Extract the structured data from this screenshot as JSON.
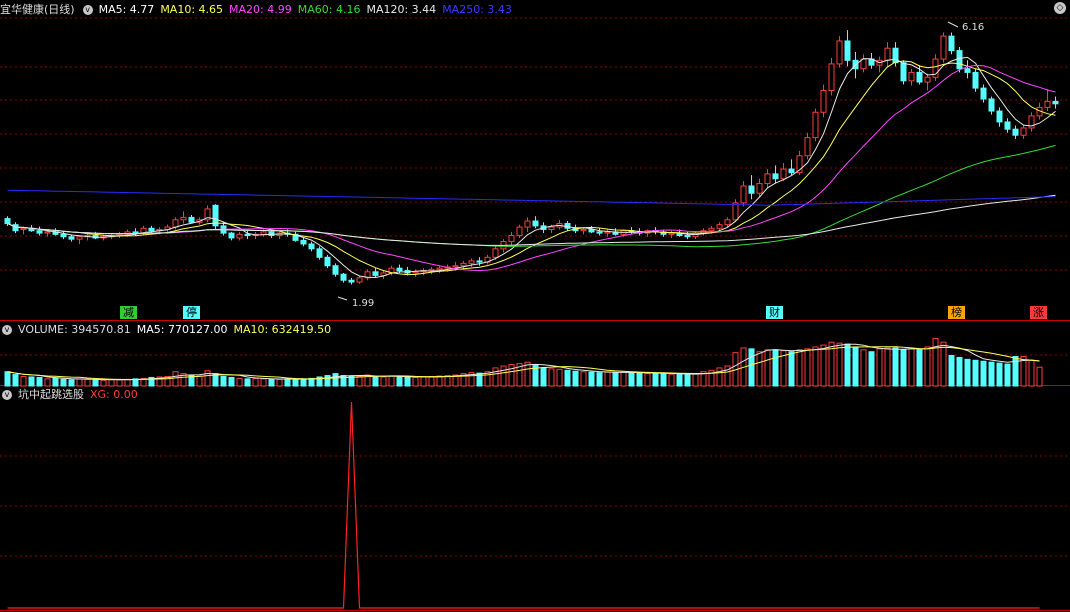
{
  "colors": {
    "up": "#ff3a3a",
    "down": "#54ffff",
    "ma5": "#e8e8e8",
    "ma10": "#ffff55",
    "ma20": "#ff44ff",
    "ma60": "#33dd33",
    "ma120": "#e8e8e8",
    "ma250": "#2a2aff",
    "grid": "#8b0000",
    "signal": "#ff2222"
  },
  "header": {
    "stock_name": "宜华健康(日线)",
    "ma5": "MA5: 4.77",
    "ma10": "MA10: 4.65",
    "ma20": "MA20: 4.99",
    "ma60": "MA60: 4.16",
    "ma120": "MA120: 3.44",
    "ma250": "MA250: 3.43"
  },
  "volume_header": {
    "volume": "VOLUME: 394570.81",
    "ma5": "MA5: 770127.00",
    "ma10": "MA10: 632419.50"
  },
  "indicator_header": {
    "name": "坑中起跳选股",
    "xg": "XG: 0.00"
  },
  "icons": {
    "collapse": "chevron-down-icon",
    "settings": "diamond-icon"
  },
  "annotations": {
    "low": "1.99",
    "high": "6.16",
    "markers": [
      {
        "text": "减",
        "bg": "#33cc33"
      },
      {
        "text": "停",
        "bg": "#54ffff"
      },
      {
        "text": "财",
        "bg": "#54ffff"
      },
      {
        "text": "榜",
        "bg": "#ffa500"
      },
      {
        "text": "涨",
        "bg": "#ff3a3a"
      }
    ]
  },
  "chart_data": [
    {
      "type": "candlestick",
      "ylim": [
        1.7,
        6.4
      ],
      "series_ohlc": [
        [
          3.08,
          3.12,
          2.96,
          3.0
        ],
        [
          2.98,
          3.02,
          2.84,
          2.88
        ],
        [
          2.9,
          2.95,
          2.82,
          2.92
        ],
        [
          2.92,
          2.97,
          2.86,
          2.88
        ],
        [
          2.88,
          2.95,
          2.8,
          2.84
        ],
        [
          2.84,
          2.9,
          2.78,
          2.86
        ],
        [
          2.86,
          2.92,
          2.8,
          2.82
        ],
        [
          2.82,
          2.87,
          2.74,
          2.78
        ],
        [
          2.78,
          2.82,
          2.7,
          2.74
        ],
        [
          2.74,
          2.8,
          2.66,
          2.78
        ],
        [
          2.78,
          2.84,
          2.72,
          2.8
        ],
        [
          2.8,
          2.86,
          2.74,
          2.76
        ],
        [
          2.76,
          2.82,
          2.72,
          2.78
        ],
        [
          2.78,
          2.84,
          2.74,
          2.8
        ],
        [
          2.8,
          2.86,
          2.76,
          2.82
        ],
        [
          2.82,
          2.9,
          2.78,
          2.86
        ],
        [
          2.86,
          2.92,
          2.8,
          2.84
        ],
        [
          2.84,
          2.96,
          2.8,
          2.92
        ],
        [
          2.92,
          2.96,
          2.84,
          2.88
        ],
        [
          2.88,
          2.94,
          2.82,
          2.9
        ],
        [
          2.9,
          2.98,
          2.86,
          2.94
        ],
        [
          2.94,
          3.1,
          2.9,
          3.06
        ],
        [
          3.06,
          3.2,
          3.0,
          3.1
        ],
        [
          3.1,
          3.14,
          3.0,
          3.02
        ],
        [
          3.02,
          3.1,
          2.98,
          3.06
        ],
        [
          3.06,
          3.3,
          3.02,
          3.24
        ],
        [
          3.3,
          3.32,
          2.9,
          2.96
        ],
        [
          2.96,
          3.02,
          2.8,
          2.84
        ],
        [
          2.84,
          2.86,
          2.72,
          2.76
        ],
        [
          2.76,
          2.86,
          2.72,
          2.82
        ],
        [
          2.82,
          2.88,
          2.74,
          2.8
        ],
        [
          2.8,
          2.86,
          2.74,
          2.82
        ],
        [
          2.82,
          2.9,
          2.78,
          2.86
        ],
        [
          2.86,
          2.9,
          2.76,
          2.8
        ],
        [
          2.8,
          2.86,
          2.74,
          2.84
        ],
        [
          2.84,
          2.9,
          2.78,
          2.82
        ],
        [
          2.82,
          2.86,
          2.7,
          2.72
        ],
        [
          2.72,
          2.76,
          2.62,
          2.66
        ],
        [
          2.66,
          2.7,
          2.54,
          2.58
        ],
        [
          2.58,
          2.62,
          2.4,
          2.44
        ],
        [
          2.44,
          2.48,
          2.26,
          2.3
        ],
        [
          2.3,
          2.34,
          2.12,
          2.16
        ],
        [
          2.16,
          2.18,
          2.02,
          2.06
        ],
        [
          2.06,
          2.1,
          1.99,
          2.03
        ],
        [
          2.03,
          2.14,
          2.0,
          2.1
        ],
        [
          2.1,
          2.24,
          2.06,
          2.2
        ],
        [
          2.2,
          2.26,
          2.1,
          2.14
        ],
        [
          2.14,
          2.22,
          2.08,
          2.18
        ],
        [
          2.18,
          2.3,
          2.14,
          2.26
        ],
        [
          2.26,
          2.32,
          2.18,
          2.22
        ],
        [
          2.22,
          2.28,
          2.14,
          2.18
        ],
        [
          2.18,
          2.24,
          2.12,
          2.2
        ],
        [
          2.2,
          2.26,
          2.14,
          2.22
        ],
        [
          2.22,
          2.28,
          2.16,
          2.24
        ],
        [
          2.24,
          2.3,
          2.18,
          2.26
        ],
        [
          2.26,
          2.32,
          2.2,
          2.28
        ],
        [
          2.28,
          2.36,
          2.22,
          2.3
        ],
        [
          2.3,
          2.38,
          2.24,
          2.34
        ],
        [
          2.34,
          2.42,
          2.28,
          2.38
        ],
        [
          2.38,
          2.44,
          2.3,
          2.36
        ],
        [
          2.36,
          2.48,
          2.32,
          2.44
        ],
        [
          2.44,
          2.62,
          2.4,
          2.58
        ],
        [
          2.58,
          2.74,
          2.52,
          2.7
        ],
        [
          2.7,
          2.86,
          2.64,
          2.8
        ],
        [
          2.8,
          2.98,
          2.76,
          2.94
        ],
        [
          2.94,
          3.1,
          2.86,
          3.04
        ],
        [
          3.04,
          3.12,
          2.92,
          2.96
        ],
        [
          2.96,
          3.02,
          2.84,
          2.9
        ],
        [
          2.9,
          2.98,
          2.84,
          2.94
        ],
        [
          2.94,
          3.06,
          2.9,
          3.0
        ],
        [
          3.0,
          3.04,
          2.88,
          2.92
        ],
        [
          2.92,
          2.98,
          2.84,
          2.88
        ],
        [
          2.88,
          2.94,
          2.82,
          2.9
        ],
        [
          2.9,
          2.96,
          2.84,
          2.86
        ],
        [
          2.86,
          2.92,
          2.8,
          2.84
        ],
        [
          2.84,
          2.9,
          2.78,
          2.86
        ],
        [
          2.86,
          2.92,
          2.8,
          2.82
        ],
        [
          2.82,
          2.9,
          2.78,
          2.88
        ],
        [
          2.88,
          2.94,
          2.82,
          2.86
        ],
        [
          2.86,
          2.92,
          2.8,
          2.84
        ],
        [
          2.84,
          2.9,
          2.78,
          2.88
        ],
        [
          2.88,
          2.94,
          2.82,
          2.86
        ],
        [
          2.86,
          2.9,
          2.78,
          2.82
        ],
        [
          2.82,
          2.88,
          2.76,
          2.84
        ],
        [
          2.84,
          2.9,
          2.78,
          2.8
        ],
        [
          2.8,
          2.86,
          2.74,
          2.78
        ],
        [
          2.78,
          2.86,
          2.74,
          2.84
        ],
        [
          2.84,
          2.92,
          2.8,
          2.88
        ],
        [
          2.88,
          2.96,
          2.84,
          2.92
        ],
        [
          2.92,
          3.02,
          2.88,
          2.98
        ],
        [
          2.98,
          3.1,
          2.94,
          3.06
        ],
        [
          3.06,
          3.4,
          3.02,
          3.34
        ],
        [
          3.34,
          3.7,
          3.28,
          3.62
        ],
        [
          3.62,
          3.8,
          3.4,
          3.5
        ],
        [
          3.5,
          3.74,
          3.44,
          3.66
        ],
        [
          3.66,
          3.9,
          3.58,
          3.82
        ],
        [
          3.82,
          3.96,
          3.66,
          3.74
        ],
        [
          3.74,
          4.0,
          3.7,
          3.9
        ],
        [
          3.9,
          4.06,
          3.8,
          3.84
        ],
        [
          3.84,
          4.2,
          3.8,
          4.12
        ],
        [
          4.12,
          4.5,
          4.06,
          4.42
        ],
        [
          4.42,
          4.9,
          4.36,
          4.84
        ],
        [
          4.84,
          5.3,
          4.76,
          5.2
        ],
        [
          5.2,
          5.74,
          5.12,
          5.64
        ],
        [
          5.64,
          6.1,
          5.58,
          6.02
        ],
        [
          6.02,
          6.2,
          5.6,
          5.7
        ],
        [
          5.7,
          5.84,
          5.4,
          5.56
        ],
        [
          5.56,
          5.8,
          5.5,
          5.72
        ],
        [
          5.72,
          5.82,
          5.56,
          5.62
        ],
        [
          5.62,
          5.76,
          5.5,
          5.7
        ],
        [
          5.7,
          6.0,
          5.6,
          5.9
        ],
        [
          5.9,
          6.0,
          5.6,
          5.66
        ],
        [
          5.66,
          5.7,
          5.3,
          5.36
        ],
        [
          5.36,
          5.56,
          5.28,
          5.5
        ],
        [
          5.5,
          5.62,
          5.3,
          5.34
        ],
        [
          5.34,
          5.48,
          5.2,
          5.42
        ],
        [
          5.42,
          5.8,
          5.36,
          5.72
        ],
        [
          5.72,
          6.16,
          5.66,
          6.1
        ],
        [
          6.1,
          6.16,
          5.8,
          5.86
        ],
        [
          5.86,
          5.92,
          5.5,
          5.56
        ],
        [
          5.56,
          5.7,
          5.4,
          5.5
        ],
        [
          5.5,
          5.56,
          5.18,
          5.24
        ],
        [
          5.24,
          5.3,
          5.0,
          5.06
        ],
        [
          5.06,
          5.1,
          4.8,
          4.86
        ],
        [
          4.86,
          4.92,
          4.6,
          4.68
        ],
        [
          4.68,
          4.74,
          4.5,
          4.56
        ],
        [
          4.56,
          4.62,
          4.4,
          4.46
        ],
        [
          4.46,
          4.62,
          4.4,
          4.58
        ],
        [
          4.58,
          4.84,
          4.52,
          4.78
        ],
        [
          4.78,
          5.0,
          4.72,
          4.92
        ],
        [
          4.92,
          5.22,
          4.86,
          5.02
        ],
        [
          5.02,
          5.1,
          4.9,
          4.98
        ]
      ]
    },
    {
      "type": "bar",
      "values": [
        300,
        240,
        200,
        190,
        180,
        150,
        160,
        140,
        130,
        150,
        140,
        130,
        120,
        130,
        130,
        140,
        150,
        160,
        180,
        190,
        200,
        300,
        260,
        220,
        210,
        320,
        260,
        200,
        180,
        160,
        150,
        160,
        150,
        140,
        140,
        150,
        140,
        150,
        160,
        190,
        220,
        260,
        220,
        200,
        200,
        230,
        200,
        190,
        210,
        200,
        180,
        180,
        190,
        200,
        210,
        220,
        230,
        260,
        280,
        270,
        300,
        380,
        420,
        450,
        470,
        500,
        430,
        380,
        360,
        350,
        330,
        310,
        300,
        290,
        280,
        290,
        280,
        290,
        280,
        270,
        260,
        270,
        260,
        250,
        240,
        240,
        260,
        300,
        330,
        380,
        420,
        700,
        800,
        780,
        720,
        760,
        760,
        740,
        720,
        760,
        780,
        820,
        860,
        920,
        900,
        880,
        820,
        760,
        720,
        780,
        800,
        800,
        760,
        780,
        760,
        820,
        1000,
        920,
        640,
        600,
        560,
        540,
        520,
        500,
        480,
        460,
        620,
        620,
        540,
        394
      ],
      "ylim": [
        0,
        1050
      ],
      "ma5": "770127.00",
      "ma10": "632419.50"
    },
    {
      "type": "line",
      "name": "XG",
      "ylim": [
        0,
        1
      ],
      "values": [
        0,
        0,
        0,
        0,
        0,
        0,
        0,
        0,
        0,
        0,
        0,
        0,
        0,
        0,
        0,
        0,
        0,
        0,
        0,
        0,
        0,
        0,
        0,
        0,
        0,
        0,
        0,
        0,
        0,
        0,
        0,
        0,
        0,
        0,
        0,
        0,
        0,
        0,
        0,
        0,
        0,
        0,
        0,
        1,
        0,
        0,
        0,
        0,
        0,
        0,
        0,
        0,
        0,
        0,
        0,
        0,
        0,
        0,
        0,
        0,
        0,
        0,
        0,
        0,
        0,
        0,
        0,
        0,
        0,
        0,
        0,
        0,
        0,
        0,
        0,
        0,
        0,
        0,
        0,
        0,
        0,
        0,
        0,
        0,
        0,
        0,
        0,
        0,
        0,
        0,
        0,
        0,
        0,
        0,
        0,
        0,
        0,
        0,
        0,
        0,
        0,
        0,
        0,
        0,
        0,
        0,
        0,
        0,
        0,
        0,
        0,
        0,
        0,
        0,
        0,
        0,
        0,
        0,
        0,
        0,
        0,
        0,
        0,
        0,
        0,
        0,
        0,
        0,
        0,
        0
      ]
    }
  ]
}
